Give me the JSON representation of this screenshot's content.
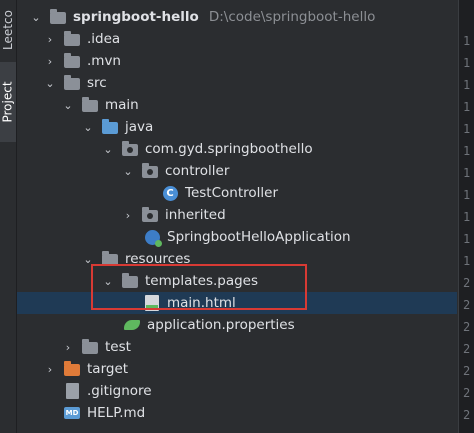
{
  "sidebar": {
    "tabs": [
      {
        "label": "Leetco"
      },
      {
        "label": "Project"
      }
    ]
  },
  "tree": {
    "rows": [
      {
        "name": "springboot-hello",
        "path": "D:\\code\\springboot-hello",
        "icon": "folder-icon",
        "expanded": true
      },
      {
        "name": ".idea",
        "icon": "folder-icon",
        "expanded": false
      },
      {
        "name": ".mvn",
        "icon": "folder-icon",
        "expanded": false
      },
      {
        "name": "src",
        "icon": "folder-icon",
        "expanded": true
      },
      {
        "name": "main",
        "icon": "folder-icon",
        "expanded": true
      },
      {
        "name": "java",
        "icon": "source-folder-icon",
        "expanded": true
      },
      {
        "name": "com.gyd.springboothello",
        "icon": "package-icon",
        "expanded": true
      },
      {
        "name": "controller",
        "icon": "package-icon",
        "expanded": true
      },
      {
        "name": "TestController",
        "icon": "class-icon"
      },
      {
        "name": "inherited",
        "icon": "package-icon",
        "expanded": false
      },
      {
        "name": "SpringbootHelloApplication",
        "icon": "spring-app-icon"
      },
      {
        "name": "resources",
        "icon": "resources-folder-icon",
        "expanded": true
      },
      {
        "name": "templates.pages",
        "icon": "folder-icon",
        "expanded": true
      },
      {
        "name": "main.html",
        "icon": "html-file-icon",
        "selected": true
      },
      {
        "name": "application.properties",
        "icon": "spring-properties-icon"
      },
      {
        "name": "test",
        "icon": "folder-icon",
        "expanded": false
      },
      {
        "name": "target",
        "icon": "excluded-folder-icon",
        "expanded": false
      },
      {
        "name": ".gitignore",
        "icon": "file-icon"
      },
      {
        "name": "HELP.md",
        "icon": "markdown-icon"
      }
    ]
  },
  "gutter": {
    "line_numbers": [
      "1",
      "1",
      "1",
      "1",
      "1",
      "1",
      "1",
      "1",
      "1",
      "1",
      "1",
      "2",
      "2",
      "2",
      "2",
      "2",
      "2",
      "2"
    ]
  },
  "colors": {
    "selection": "#1f3a55",
    "highlight_box": "#d83a34",
    "background": "#2b2d30"
  }
}
